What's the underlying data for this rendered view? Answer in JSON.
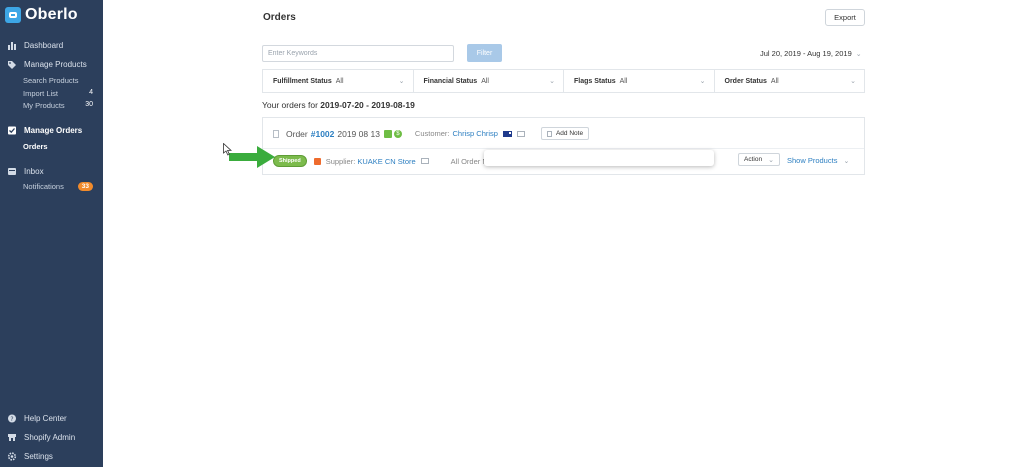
{
  "brand": {
    "name": "Oberlo"
  },
  "sidebar": {
    "dashboard": "Dashboard",
    "manage_products": "Manage Products",
    "search_products": "Search Products",
    "import_list": "Import List",
    "import_list_count": "4",
    "my_products": "My Products",
    "my_products_count": "30",
    "manage_orders": "Manage Orders",
    "orders": "Orders",
    "inbox": "Inbox",
    "notifications": "Notifications",
    "notifications_count": "33",
    "help_center": "Help Center",
    "shopify_admin": "Shopify Admin",
    "settings": "Settings"
  },
  "header": {
    "title": "Orders",
    "export_label": "Export"
  },
  "search": {
    "placeholder": "Enter Keywords",
    "filter_label": "Filter",
    "date_range": "Jul 20, 2019 - Aug 19, 2019"
  },
  "filters": [
    {
      "label": "Fulfillment Status",
      "value": "All"
    },
    {
      "label": "Financial Status",
      "value": "All"
    },
    {
      "label": "Flags Status",
      "value": "All"
    },
    {
      "label": "Order Status",
      "value": "All"
    }
  ],
  "summary": {
    "prefix": "Your orders for",
    "range": "2019-07-20 - 2019-08-19"
  },
  "order": {
    "label": "Order",
    "number": "#1002",
    "date": "2019 08 13",
    "customer_label": "Customer:",
    "customer_name": "Chrisp Chrisp",
    "add_note": "Add Note",
    "status": "Shipped",
    "supplier_label": "Supplier:",
    "supplier_name": "KUAKE CN Store",
    "order_no_label": "All Order No:",
    "action_label": "Action",
    "show_products": "Show Products"
  },
  "colors": {
    "sidebar": "#2c3f5c",
    "link": "#2d7fc1",
    "shipped": "#7cbb4c",
    "arrow": "#3aac3d"
  }
}
